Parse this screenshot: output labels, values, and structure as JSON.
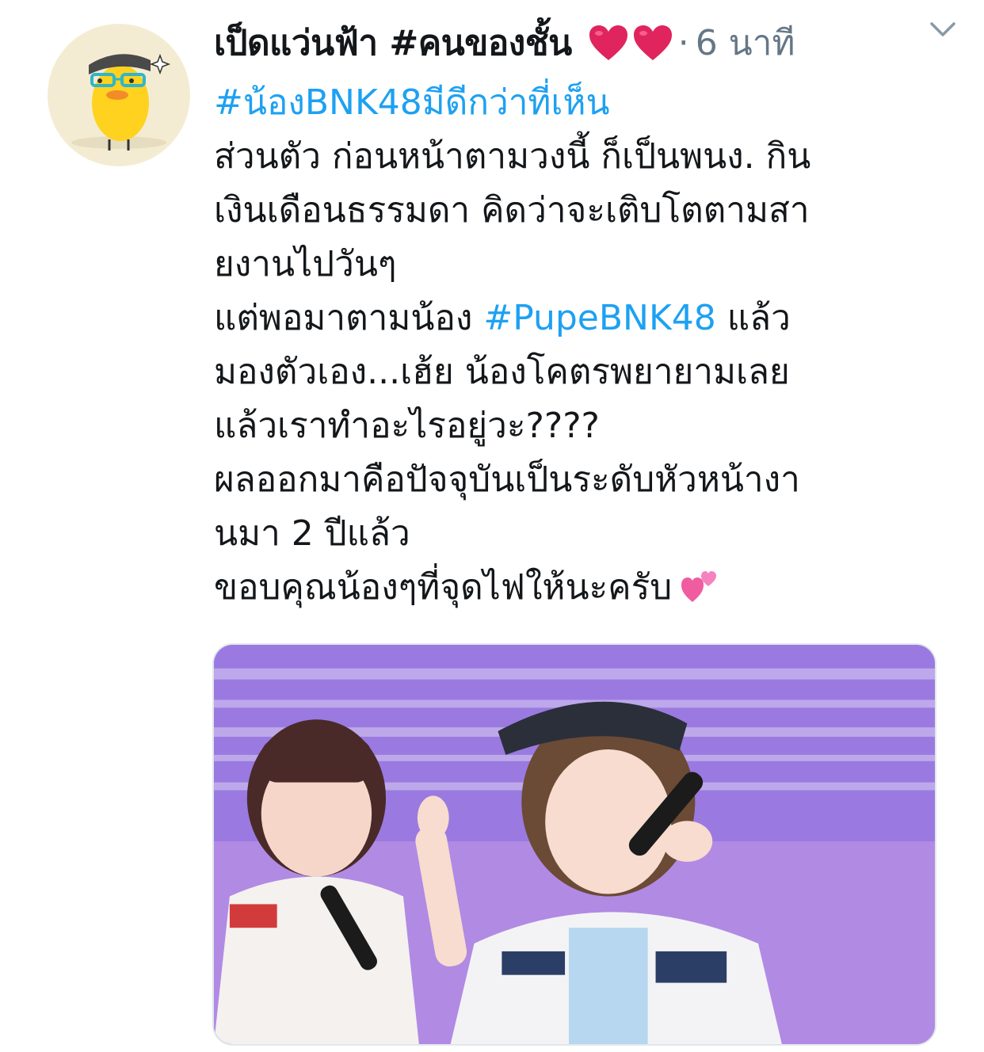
{
  "tweet": {
    "display_name": "เป็ดแว่นฟ้า #คนของชั้น",
    "name_emoji": "❤️❤️",
    "separator": "·",
    "timestamp": "6 นาที",
    "menu_icon": "chevron-down-icon",
    "lines": [
      {
        "parts": [
          {
            "text": "#น้องBNK48มีดีกว่าที่เห็น",
            "link": true
          }
        ]
      },
      {
        "parts": [
          {
            "text": "ส่วนตัว ก่อนหน้าตามวงนี้ ก็เป็นพนง. กิน",
            "link": false
          }
        ]
      },
      {
        "parts": [
          {
            "text": "เงินเดือนธรรมดา คิดว่าจะเติบโตตามสา",
            "link": false
          }
        ]
      },
      {
        "parts": [
          {
            "text": "ยงานไปวันๆ",
            "link": false
          }
        ]
      },
      {
        "parts": [
          {
            "text": "แต่พอมาตามน้อง ",
            "link": false
          },
          {
            "text": "#PupeBNK48",
            "link": true
          },
          {
            "text": " แล้ว",
            "link": false
          }
        ]
      },
      {
        "parts": [
          {
            "text": "มองตัวเอง...เฮ้ย น้องโคตรพยายามเลย",
            "link": false
          }
        ]
      },
      {
        "parts": [
          {
            "text": "แล้วเราทำอะไรอยู่วะ????",
            "link": false
          }
        ]
      },
      {
        "parts": [
          {
            "text": "ผลออกมาคือปัจจุบันเป็นระดับหัวหน้างา",
            "link": false
          }
        ]
      },
      {
        "parts": [
          {
            "text": "นมา 2 ปีแล้ว",
            "link": false
          }
        ]
      },
      {
        "parts": [
          {
            "text": "ขอบคุณน้องๆที่จุดไฟให้นะครับ",
            "link": false
          }
        ]
      }
    ],
    "trailing_emoji": "💕",
    "colors": {
      "link": "#1da1f2",
      "meta": "#657786",
      "text": "#14171a",
      "heart": "#e0245e"
    }
  }
}
